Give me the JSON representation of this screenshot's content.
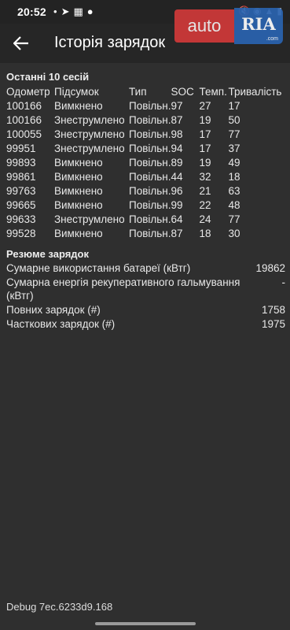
{
  "status": {
    "time": "20:52",
    "icons": [
      "notification-icon",
      "telegram-icon",
      "screenshot-icon",
      "app-icon"
    ],
    "right_icons": [
      "mute-icon",
      "wifi-icon",
      "signal-icon",
      "battery-icon"
    ]
  },
  "toolbar": {
    "title": "Історія зарядок"
  },
  "watermark": {
    "left": "auto",
    "right": "RIA",
    "suffix": ".com"
  },
  "history": {
    "title": "Останні 10 сесій",
    "columns": {
      "odometer": "Одометр",
      "summary": "Підсумок",
      "type": "Тип",
      "soc": "SOC",
      "temp": "Темп.",
      "duration": "Тривалість"
    },
    "rows": [
      {
        "odometer": "100166",
        "summary": "Вимкнено",
        "type": "Повільн.",
        "soc": "97",
        "temp": "27",
        "duration": "17"
      },
      {
        "odometer": "100166",
        "summary": "Знеструмлено",
        "type": "Повільн.",
        "soc": "87",
        "temp": "19",
        "duration": "50"
      },
      {
        "odometer": "100055",
        "summary": "Знеструмлено",
        "type": "Повільн.",
        "soc": "98",
        "temp": "17",
        "duration": "77"
      },
      {
        "odometer": "99951",
        "summary": "Знеструмлено",
        "type": "Повільн.",
        "soc": "94",
        "temp": "17",
        "duration": "37"
      },
      {
        "odometer": "99893",
        "summary": "Вимкнено",
        "type": "Повільн.",
        "soc": "89",
        "temp": "19",
        "duration": "49"
      },
      {
        "odometer": "99861",
        "summary": "Вимкнено",
        "type": "Повільн.",
        "soc": "44",
        "temp": "32",
        "duration": "18"
      },
      {
        "odometer": "99763",
        "summary": "Вимкнено",
        "type": "Повільн.",
        "soc": "96",
        "temp": "21",
        "duration": "63"
      },
      {
        "odometer": "99665",
        "summary": "Вимкнено",
        "type": "Повільн.",
        "soc": "99",
        "temp": "22",
        "duration": "48"
      },
      {
        "odometer": "99633",
        "summary": "Знеструмлено",
        "type": "Повільн.",
        "soc": "64",
        "temp": "24",
        "duration": "77"
      },
      {
        "odometer": "99528",
        "summary": "Вимкнено",
        "type": "Повільн.",
        "soc": "87",
        "temp": "18",
        "duration": "30"
      }
    ]
  },
  "summary": {
    "title": "Резюме зарядок",
    "items": [
      {
        "label": "Сумарне використання батареї (кВтг)",
        "value": "19862"
      },
      {
        "label": "Сумарна енергія рекуперативного гальмування (кВтг)",
        "value": "-"
      },
      {
        "label": "Повних зарядок (#)",
        "value": "1758"
      },
      {
        "label": "Часткових зарядок (#)",
        "value": "1975"
      }
    ]
  },
  "debug": "Debug 7ec.6233d9.168",
  "colors": {
    "background": "#2f2f2f",
    "toolbar": "#262626",
    "text": "#e8e8e8",
    "watermark_red": "#d93a3a",
    "watermark_blue": "#2a63b0"
  }
}
